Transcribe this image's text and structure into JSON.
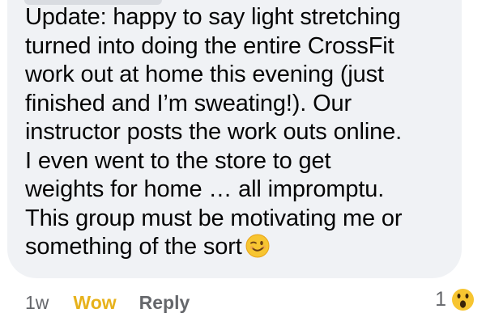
{
  "comment": {
    "lines": [
      "Update: happy to say light stretching",
      "turned into doing the entire CrossFit",
      "work out at home this evening (just",
      "finished and I’m sweating!). Our",
      "instructor posts the work outs online.",
      "I even went to the store to get",
      "weights for home … all impromptu.",
      "This group must be motivating me or",
      "something of the sort"
    ],
    "emoji_icon": "winking-face"
  },
  "actions": {
    "time": "1w",
    "reaction_label": "Wow",
    "reply_label": "Reply"
  },
  "reactions": {
    "count": "1",
    "icon": "wow-face",
    "accent": "#e7b21c"
  }
}
